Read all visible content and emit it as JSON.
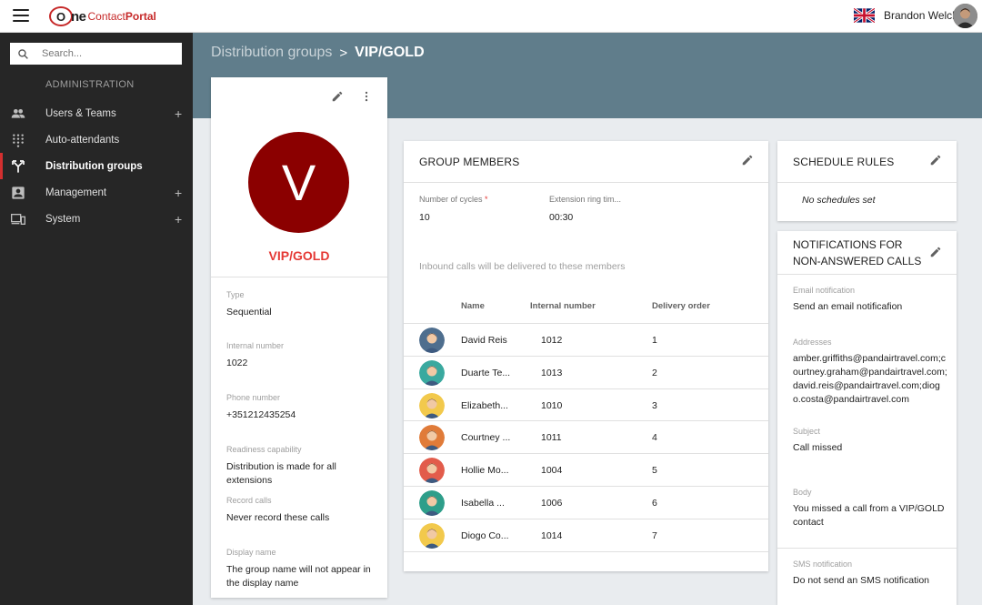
{
  "topbar": {
    "logo_one": "ne",
    "logo_o": "O",
    "logo_contact": "Contact",
    "logo_portal": "Portal",
    "user_name": "Brandon Welch"
  },
  "sidebar": {
    "search_placeholder": "Search...",
    "section_label": "ADMINISTRATION",
    "items": [
      {
        "label": "Users & Teams",
        "icon": "people-icon",
        "expandable": "+"
      },
      {
        "label": "Auto-attendants",
        "icon": "dialpad-icon",
        "expandable": ""
      },
      {
        "label": "Distribution groups",
        "icon": "call-split-icon",
        "expandable": "",
        "active": true
      },
      {
        "label": "Management",
        "icon": "contact-card-icon",
        "expandable": "+"
      },
      {
        "label": "System",
        "icon": "devices-icon",
        "expandable": "+"
      }
    ]
  },
  "breadcrumb": {
    "parent": "Distribution groups",
    "separator": ">",
    "current": "VIP/GOLD"
  },
  "profile": {
    "initial": "V",
    "name": "VIP/GOLD",
    "avatar_color": "#8b0000",
    "fields": [
      {
        "label": "Type",
        "value": "Sequential"
      },
      {
        "label": "Internal number",
        "value": "1022"
      },
      {
        "label": "Phone number",
        "value": "+351212435254"
      },
      {
        "label": "Readiness capability",
        "value": "Distribution is made for all extensions"
      },
      {
        "label": "Record calls",
        "value": "Never record these calls"
      },
      {
        "label": "Display name",
        "value": "The group name will not appear in the display name"
      }
    ]
  },
  "members": {
    "title": "GROUP MEMBERS",
    "cycles_label": "Number of cycles",
    "cycles_required": "*",
    "cycles_value": "10",
    "ring_label": "Extension ring tim...",
    "ring_value": "00:30",
    "note": "Inbound calls will be delivered to these members",
    "columns": {
      "name": "Name",
      "internal": "Internal number",
      "order": "Delivery order"
    },
    "rows": [
      {
        "name": "David Reis",
        "internal": "1012",
        "order": "1",
        "avatar_bg": "#4e6e8e"
      },
      {
        "name": "Duarte Te...",
        "internal": "1013",
        "order": "2",
        "avatar_bg": "#3aa99f"
      },
      {
        "name": "Elizabeth...",
        "internal": "1010",
        "order": "3",
        "avatar_bg": "#f2c94c"
      },
      {
        "name": "Courtney ...",
        "internal": "1011",
        "order": "4",
        "avatar_bg": "#e07b39"
      },
      {
        "name": "Hollie Mo...",
        "internal": "1004",
        "order": "5",
        "avatar_bg": "#e25c4b"
      },
      {
        "name": "Isabella ...",
        "internal": "1006",
        "order": "6",
        "avatar_bg": "#2e9e8a"
      },
      {
        "name": "Diogo Co...",
        "internal": "1014",
        "order": "7",
        "avatar_bg": "#f2c94c"
      }
    ]
  },
  "schedule": {
    "title": "SCHEDULE RULES",
    "empty": "No schedules set"
  },
  "notifications": {
    "title": "NOTIFICATIONS FOR NON-ANSWERED CALLS",
    "fields": [
      {
        "label": "Email notification",
        "value": "Send an email notificafion"
      },
      {
        "label": "Addresses",
        "value": "amber.griffiths@pandairtravel.com;courtney.graham@pandairtravel.com;david.reis@pandairtravel.com;diogo.costa@pandairtravel.com"
      },
      {
        "label": "Subject",
        "value": "Call missed"
      },
      {
        "label": "Body",
        "value": "You missed a call from a VIP/GOLD contact"
      },
      {
        "label": "SMS notification",
        "value": "Do not send an SMS notification"
      }
    ]
  },
  "colors": {
    "accent_red": "#e53935",
    "header_band": "#607d8b",
    "sidebar_bg": "#262626"
  }
}
